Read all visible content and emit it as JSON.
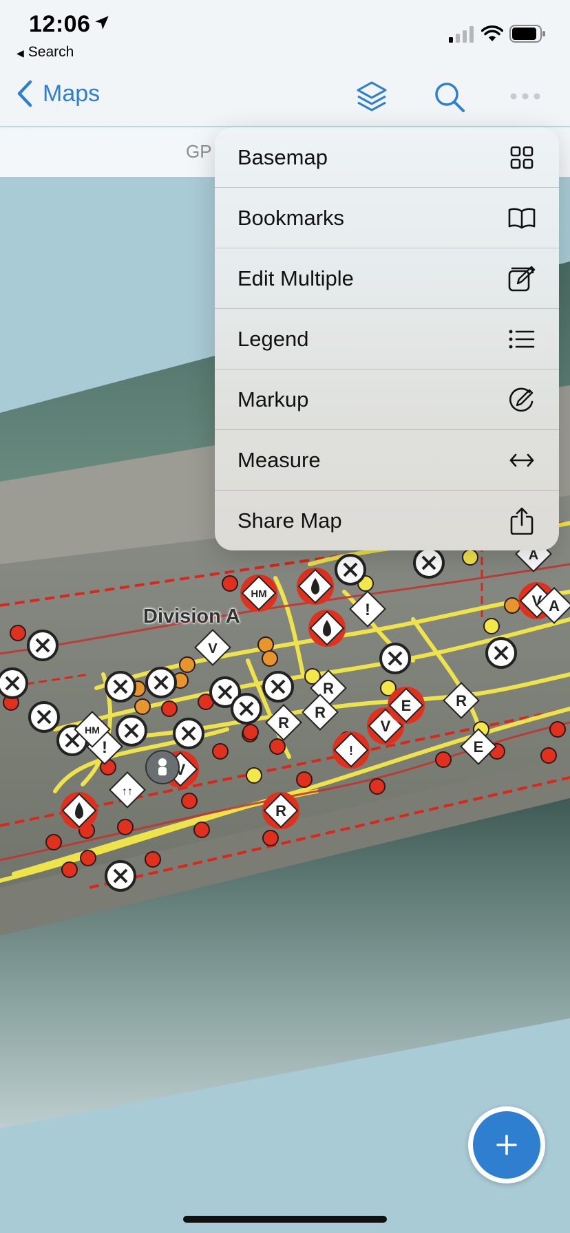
{
  "status_bar": {
    "time": "12:06",
    "back_app_label": "Search"
  },
  "nav": {
    "back_label": "Maps",
    "icons": [
      "layers-icon",
      "search-icon",
      "more-icon"
    ]
  },
  "subbar": {
    "text": "GP"
  },
  "menu": {
    "items": [
      {
        "label": "Basemap",
        "icon": "grid-icon"
      },
      {
        "label": "Bookmarks",
        "icon": "book-icon"
      },
      {
        "label": "Edit Multiple",
        "icon": "edit-square-icon"
      },
      {
        "label": "Legend",
        "icon": "list-icon"
      },
      {
        "label": "Markup",
        "icon": "pen-circle-icon"
      },
      {
        "label": "Measure",
        "icon": "arrows-horizontal-icon"
      },
      {
        "label": "Share Map",
        "icon": "share-icon"
      }
    ]
  },
  "map": {
    "label": "Division A"
  },
  "fab": {
    "icon": "plus-icon"
  },
  "colors": {
    "accent": "#2f7fd1",
    "water": "#a9cbd6",
    "track": "#f5e94a",
    "marker_red": "#e0301e"
  }
}
